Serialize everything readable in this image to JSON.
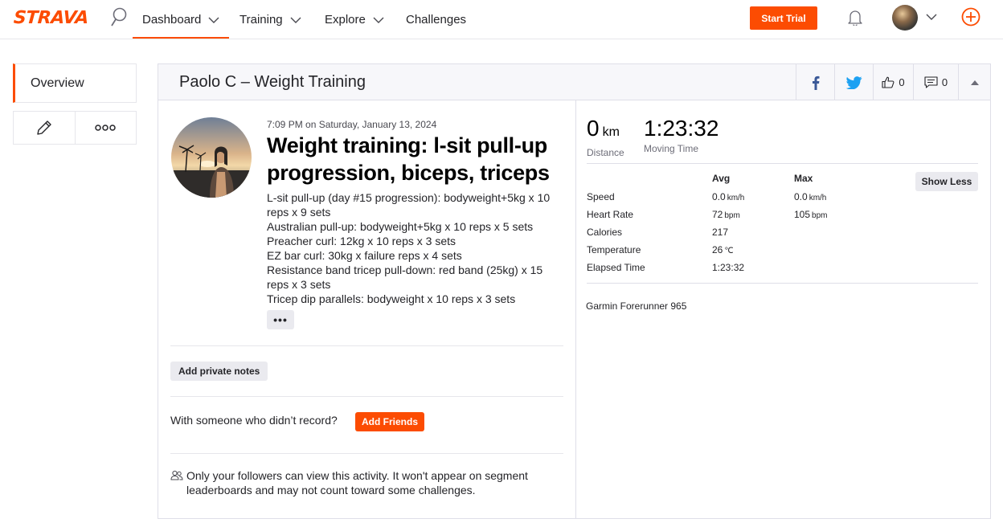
{
  "nav": {
    "logo": "STRAVA",
    "items": [
      {
        "label": "Dashboard"
      },
      {
        "label": "Training"
      },
      {
        "label": "Explore"
      },
      {
        "label": "Challenges"
      }
    ],
    "start_trial": "Start Trial",
    "accent": "#fc4c02"
  },
  "sidebar": {
    "overview": "Overview"
  },
  "header": {
    "title": "Paolo C – Weight Training",
    "kudos_count": "0",
    "comments_count": "0"
  },
  "activity": {
    "datetime": "7:09 PM on Saturday, January 13, 2024",
    "title": "Weight training: l-sit pull-up progression, biceps, triceps",
    "description": [
      "L-sit pull-up (day #15 progression): bodyweight+5kg x 10 reps x 9 sets",
      "Australian pull-up: bodyweight+5kg x 10 reps x 5 sets",
      "Preacher curl: 12kg x 10 reps x 3 sets",
      "EZ bar curl: 30kg x failure reps x 4 sets",
      "Resistance band tricep pull-down: red band (25kg) x 15 reps x 3 sets",
      "Tricep dip parallels: bodyweight x 10 reps x 3 sets"
    ],
    "more_label": "•••",
    "add_notes": "Add private notes",
    "with_someone": "With someone who didn’t record?",
    "add_friends": "Add Friends",
    "privacy": "Only your followers can view this activity. It won't appear on segment leaderboards and may not count toward some challenges."
  },
  "stats": {
    "distance_value": "0",
    "distance_unit": "km",
    "distance_label": "Distance",
    "moving_time_value": "1:23:32",
    "moving_time_label": "Moving Time",
    "col_avg": "Avg",
    "col_max": "Max",
    "show_less": "Show Less",
    "rows": [
      {
        "label": "Speed",
        "avg": "0.0",
        "avg_unit": "km/h",
        "max": "0.0",
        "max_unit": "km/h"
      },
      {
        "label": "Heart Rate",
        "avg": "72",
        "avg_unit": "bpm",
        "max": "105",
        "max_unit": "bpm"
      },
      {
        "label": "Calories",
        "avg": "217",
        "avg_unit": "",
        "max": "",
        "max_unit": ""
      },
      {
        "label": "Temperature",
        "avg": "26",
        "avg_unit": "℃",
        "max": "",
        "max_unit": ""
      },
      {
        "label": "Elapsed Time",
        "avg": "1:23:32",
        "avg_unit": "",
        "max": "",
        "max_unit": ""
      }
    ],
    "device": "Garmin Forerunner 965"
  }
}
